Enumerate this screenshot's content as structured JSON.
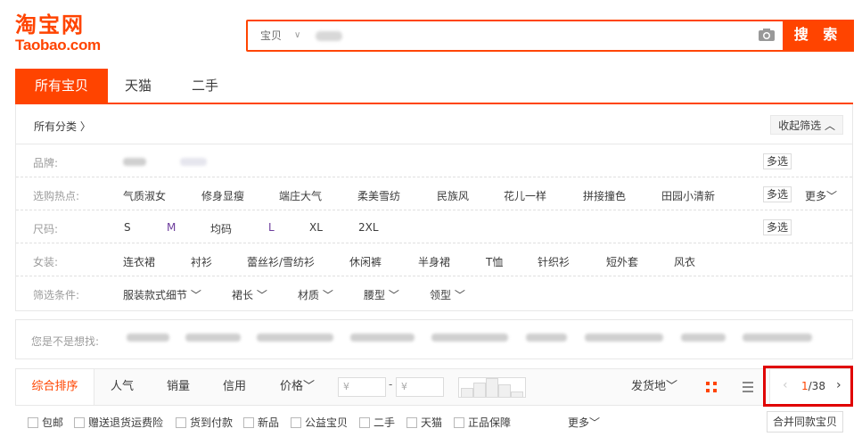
{
  "logo": {
    "cn": "淘宝网",
    "en": "Taobao.com"
  },
  "search": {
    "scope": "宝贝",
    "button": "搜 索"
  },
  "tabs": [
    "所有宝贝",
    "天猫",
    "二手"
  ],
  "crumb": {
    "all": "所有分类 〉",
    "collapse": "收起筛选 ︿"
  },
  "filters": {
    "brand_label": "品牌:",
    "hot_label": "选购热点:",
    "hot_items": [
      "气质淑女",
      "修身显瘦",
      "端庄大气",
      "柔美雪纺",
      "民族风",
      "花儿一样",
      "拼接撞色",
      "田园小清新"
    ],
    "size_label": "尺码:",
    "size_items": [
      "S",
      "M",
      "均码",
      "L",
      "XL",
      "2XL"
    ],
    "women_label": "女装:",
    "women_items": [
      "连衣裙",
      "衬衫",
      "蕾丝衫/雪纺衫",
      "休闲裤",
      "半身裙",
      "T恤",
      "针织衫",
      "短外套",
      "风衣"
    ],
    "cond_label": "筛选条件:",
    "cond_items": [
      "服装款式细节 ﹀",
      "裙长 ﹀",
      "材质 ﹀",
      "腰型 ﹀",
      "领型 ﹀"
    ],
    "multi": "多选",
    "more": "更多﹀"
  },
  "did_you_mean": {
    "label": "您是不是想找:"
  },
  "sort": {
    "items": [
      "综合排序",
      "人气",
      "销量",
      "信用",
      "价格﹀"
    ],
    "price_from": "¥",
    "price_to": "¥",
    "dash": "-",
    "ship_from": "发货地﹀"
  },
  "pager": {
    "current": "1",
    "total": "/38"
  },
  "checkboxes": [
    "包邮",
    "赠送退货运费险",
    "货到付款",
    "新品",
    "公益宝贝",
    "二手",
    "天猫",
    "正品保障"
  ],
  "checkbox_more": "更多﹀",
  "merge": "合并同款宝贝",
  "colors": {
    "brand": "#ff4400",
    "highlight": "#e00000"
  }
}
